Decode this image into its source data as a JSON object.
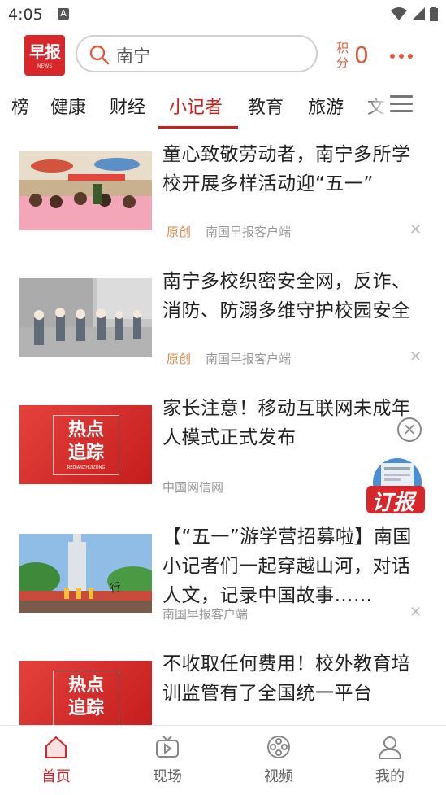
{
  "status_bar": {
    "time": "4:05",
    "notification_icon": "A"
  },
  "header": {
    "logo_text": "早报",
    "logo_sub": "NEWS",
    "search_text": "南宁",
    "points_label": "积分",
    "points_value": "0"
  },
  "tabs": {
    "items": [
      "榜",
      "健康",
      "财经",
      "小记者",
      "教育",
      "旅游",
      "文"
    ],
    "active": "小记者"
  },
  "news": [
    {
      "title": "童心致敬劳动者，南宁多所学校开展多样活动迎“五一”",
      "tag": "原创",
      "source": "南国早报客户端",
      "thumb": "festival-photo"
    },
    {
      "title": "南宁多校织密安全网，反诈、消防、防溺多维守护校园安全",
      "tag": "原创",
      "source": "南国早报客户端",
      "thumb": "drill-photo"
    },
    {
      "title": "家长注意！移动互联网未成年人模式正式发布",
      "tag": "",
      "source": "中国网信网",
      "thumb": "hot-topic",
      "thumb_line1": "热点",
      "thumb_line2": "追踪",
      "thumb_sub": "REDIANZHUIZONG"
    },
    {
      "title": "【“五一”游学营招募啦】南国小记者们一起穿越山河，对话人文，记录中国故事……",
      "tag": "",
      "source": "南国早报客户端",
      "thumb": "campus-photo"
    },
    {
      "title": "不收取任何费用！校外教育培训监管有了全国统一平台",
      "tag": "",
      "source": "",
      "thumb": "hot-topic",
      "thumb_line1": "热点",
      "thumb_line2": "追踪",
      "thumb_sub": ""
    }
  ],
  "floating": {
    "subscribe_label": "订报"
  },
  "bottom_nav": [
    {
      "label": "首页",
      "icon": "home-icon",
      "active": true
    },
    {
      "label": "现场",
      "icon": "tv-icon",
      "active": false
    },
    {
      "label": "视频",
      "icon": "film-reel-icon",
      "active": false
    },
    {
      "label": "我的",
      "icon": "user-icon",
      "active": false
    }
  ],
  "colors": {
    "brand_red": "#d8262a",
    "accent_orange": "#e05a3d",
    "origin_tag": "#e08a4a"
  }
}
